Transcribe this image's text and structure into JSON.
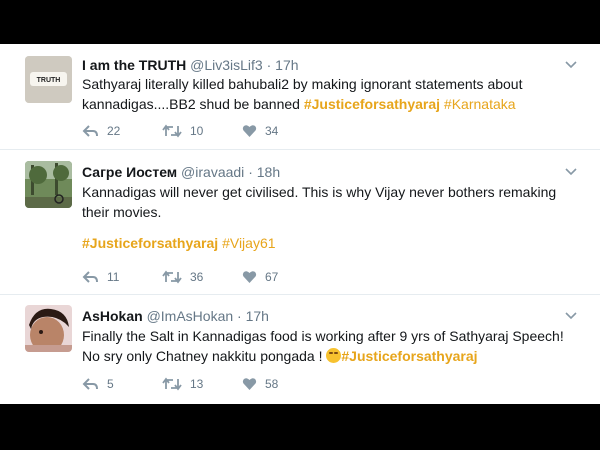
{
  "tweets": [
    {
      "name": "I am the TRUTH",
      "handle": "@Liv3isLif3",
      "dot": "·",
      "time": "17h",
      "avatar_label": "TRUTH",
      "text_plain": "Sathyaraj literally killed bahubali2 by making ignorant statements about kannadigas....BB2 shud be banned ",
      "tags": [
        "#Justiceforsathyaraj",
        "#Karnataka"
      ],
      "reply_count": "22",
      "retweet_count": "10",
      "like_count": "34"
    },
    {
      "name": "Сагре Иостем",
      "handle": "@iravaadi",
      "dot": "·",
      "time": "18h",
      "text_plain": "Kannadigas will never get civilised. This is why Vijay never bothers remaking their movies.",
      "tags": [
        "#Justiceforsathyaraj",
        "#Vijay61"
      ],
      "reply_count": "11",
      "retweet_count": "36",
      "like_count": "67"
    },
    {
      "name": "AsHokan",
      "handle": "@ImAsHokan",
      "dot": "·",
      "time": "17h",
      "text_line1": "Finally the Salt in Kannadigas food is working after 9 yrs of Sathyaraj Speech!",
      "text_line2": "No sry only Chatney nakkitu pongada ! ",
      "tags": [
        "#Justiceforsathyaraj"
      ],
      "reply_count": "5",
      "retweet_count": "13",
      "like_count": "58"
    }
  ],
  "icons": [
    "reply-icon",
    "retweet-icon",
    "like-icon",
    "chevron-down-icon"
  ],
  "colors": {
    "hashtag": "#e7a51b",
    "meta": "#657786",
    "background": "#000000"
  }
}
